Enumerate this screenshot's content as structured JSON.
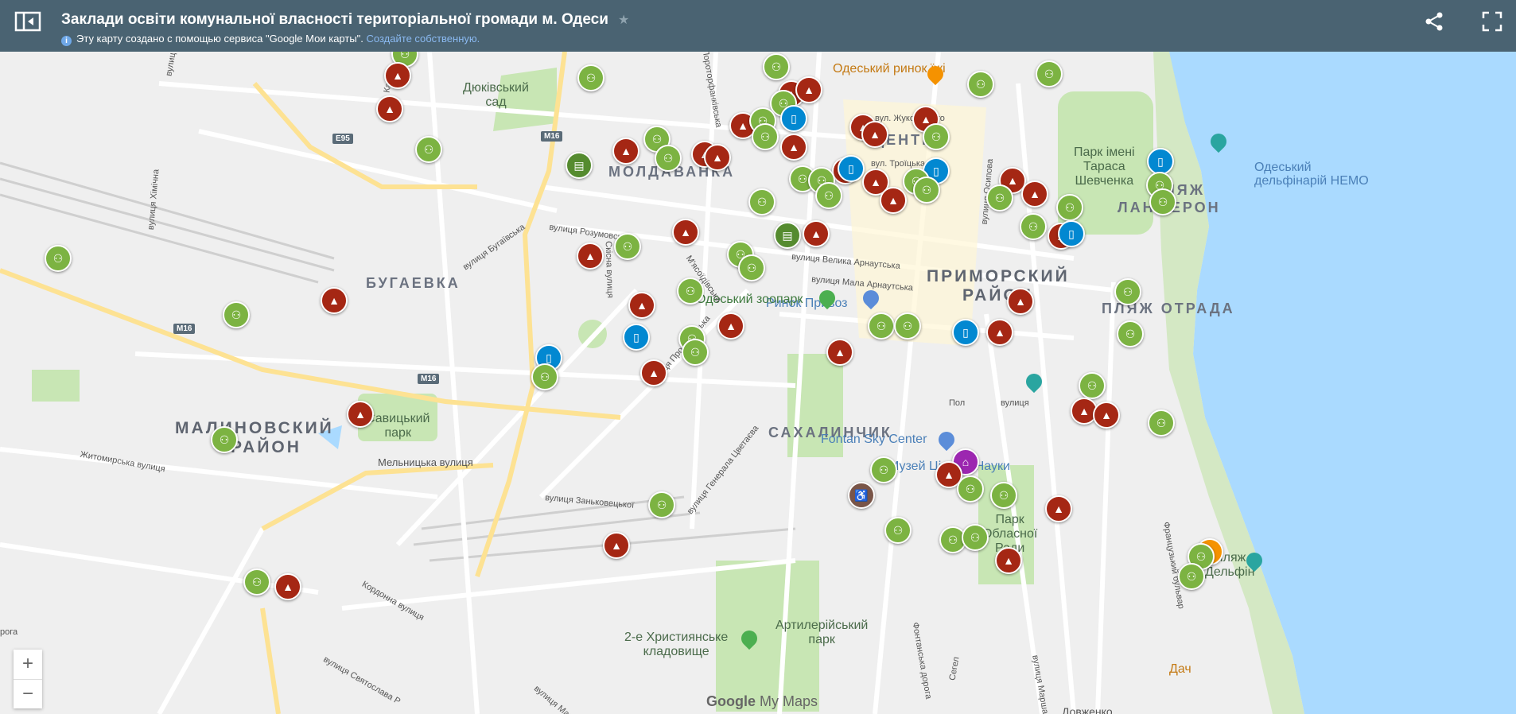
{
  "header": {
    "title": "Заклади освіти комунальної власності територіальної громади м. Одеси",
    "subtitle": "Эту карту создано с помощью сервиса \"Google Мои карты\".",
    "create_link": "Создайте собственную.",
    "info_icon": "info-icon",
    "star_icon": "star-icon",
    "share_icon": "share-icon",
    "fullscreen_icon": "fullscreen-icon",
    "sidebar_icon": "sidebar-toggle-icon"
  },
  "map": {
    "districts": {
      "moldavanka": "МОЛДАВАНКА",
      "tsentr": "ЦЕНТР",
      "bugaevka": "БУГАЕВКА",
      "malinovsky_1": "МАЛИНОВСКИЙ",
      "malinovsky_2": "РАЙОН",
      "prymorsky_1": "ПРИМОРСКИЙ",
      "prymorsky_2": "РАЙОН",
      "sakhalinchik": "САХАЛИНЧИК",
      "plyazh_lanzheron": "ПЛЯЖ ЛАНЖЕРОН",
      "plyazh_otrada": "ПЛЯЖ ОТРАДА"
    },
    "places": {
      "dyukivsky_1": "Дюківський",
      "dyukivsky_2": "сад",
      "savytsky_1": "Савицький",
      "savytsky_2": "парк",
      "shevchenka_1": "Парк імені",
      "shevchenka_2": "Тараса",
      "shevchenka_3": "Шевченка",
      "oblasnoi_1": "Парк",
      "oblasnoi_2": "Обласної",
      "oblasnoi_3": "Ради",
      "artilerysky_1": "Артилерійський",
      "artilerysky_2": "парк",
      "kladovyshche_1": "2-е Християнське",
      "kladovyshche_2": "кладовище",
      "plyazh_delfin_1": "Пляж",
      "plyazh_delfin_2": "Дельфін",
      "dacha": "Дач"
    },
    "pois": {
      "rynok_izhi": "Одеський ринок їжі",
      "rynok_pryvoz": "Ринок Привоз",
      "zoopark": "Одеський зоопарк",
      "delfinariy_1": "Одеський",
      "delfinariy_2": "дельфінарій НЕМО",
      "fontan_sky": "Fontan Sky Center",
      "muzei": "Музей Цікавої Науки"
    },
    "streets": {
      "zhukovskogo": "вул. Жуковського",
      "troitska": "вул. Троїцька",
      "velyka_arnautska": "вулиця Велика Арнаутська",
      "mala_arnautska": "вулиця Мала Арнаутська",
      "rozumovska": "вулиця Розумовська",
      "bugaivska": "вулиця Бугаївська",
      "skisna": "Скісна вулиця",
      "myasoyidivska": "М'ясоїдівська",
      "prokhorovska": "вулиця Прохоровська",
      "heneral_tsvetaeva": "вулиця Генерала Цветаєва",
      "zankovetskoi": "вулиця Заньковецької",
      "melnytska": "Мельницька вулиця",
      "zhytomyrska": "Житомирська вулиця",
      "khimichna": "вулиця Хімічна",
      "osypova": "вулиця Осипова",
      "frantsuzky": "Французький бульвар",
      "kordonna": "Кордонна вулиця",
      "sviatoslava": "вулиця Святослава Р",
      "fontanska": "Фонтанська дорога",
      "pushkinska_partial": "Пол",
      "kanatna_partial": "вулиця",
      "pre_left": "рога",
      "vul_top": "вулиц",
      "vul_kan": "вул. Кан",
      "prokopov": "Пороторфанківська",
      "seg": "Сегел",
      "marsh": "вулиця Марша",
      "mari": "вулиця Мари",
      "dovzhenko": "Довженко"
    },
    "shields": {
      "m16_a": "M16",
      "m16_b": "M16",
      "m16_c": "M16",
      "e95": "E95"
    },
    "layer_colors": {
      "school": "#a52714",
      "kindergarten": "#7cb342",
      "library": "#0288d1",
      "sports": "#558b2f",
      "water": "#aadaff",
      "park": "#c8e6b4"
    }
  },
  "controls": {
    "zoom_in": "+",
    "zoom_out": "−",
    "brand_1": "Google",
    "brand_2": " My Maps"
  }
}
